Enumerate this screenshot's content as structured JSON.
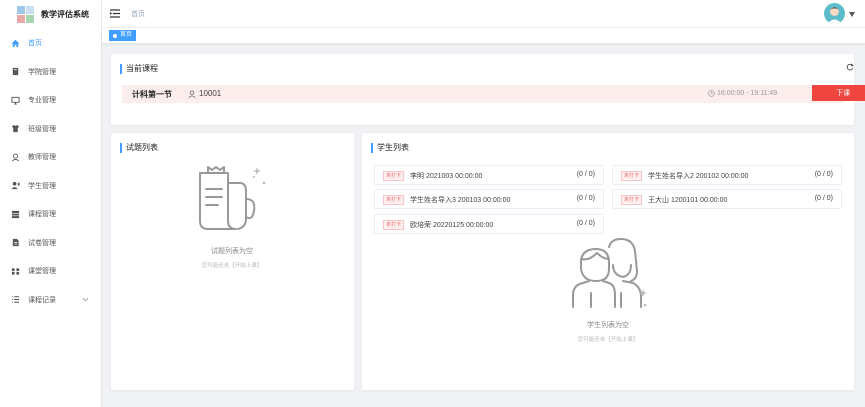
{
  "app": {
    "title": "教学评估系统"
  },
  "sidebar": {
    "items": [
      {
        "label": "首页",
        "icon": "home-icon",
        "active": true
      },
      {
        "label": "学院管理",
        "icon": "book-icon"
      },
      {
        "label": "专业管理",
        "icon": "monitor-icon"
      },
      {
        "label": "班级管理",
        "icon": "shirt-icon"
      },
      {
        "label": "教师管理",
        "icon": "teacher-icon"
      },
      {
        "label": "学生管理",
        "icon": "student-icon"
      },
      {
        "label": "课程管理",
        "icon": "grid-icon"
      },
      {
        "label": "试卷管理",
        "icon": "paper-icon"
      },
      {
        "label": "课堂管理",
        "icon": "classroom-icon"
      },
      {
        "label": "课程记录",
        "icon": "list-icon",
        "expandable": true
      }
    ]
  },
  "topbar": {
    "breadcrumb": "首页"
  },
  "tags": {
    "current": "首页"
  },
  "current_course": {
    "title": "当前课程",
    "name": "计科第一节",
    "user": "10001",
    "time": "16:00:00 - 19:11:49",
    "end_button": "下课"
  },
  "questions": {
    "title": "试题列表",
    "empty_text": "试题列表为空",
    "empty_hint": "您可能还未【开始上课】"
  },
  "students": {
    "title": "学生列表",
    "items": [
      {
        "tag": "未打卡",
        "text": "李明  2021003  00:00:00",
        "count": "(0 / 0)"
      },
      {
        "tag": "未打卡",
        "text": "学生姓名导入2  200102  00:00:00",
        "count": "(0 / 0)"
      },
      {
        "tag": "未打卡",
        "text": "学生姓名导入3  200103  00:00:00",
        "count": "(0 / 0)"
      },
      {
        "tag": "未打卡",
        "text": "王大山  1200101  00:00:00",
        "count": "(0 / 0)"
      },
      {
        "tag": "未打卡",
        "text": "欧培荣  20220125  00:00:00",
        "count": "(0 / 0)"
      }
    ],
    "empty_text": "学生列表为空",
    "empty_hint": "您可能还未【开始上课】"
  },
  "colors": {
    "accent": "#409eff",
    "danger": "#f0453f",
    "tag_bg": "#fef0f0"
  }
}
